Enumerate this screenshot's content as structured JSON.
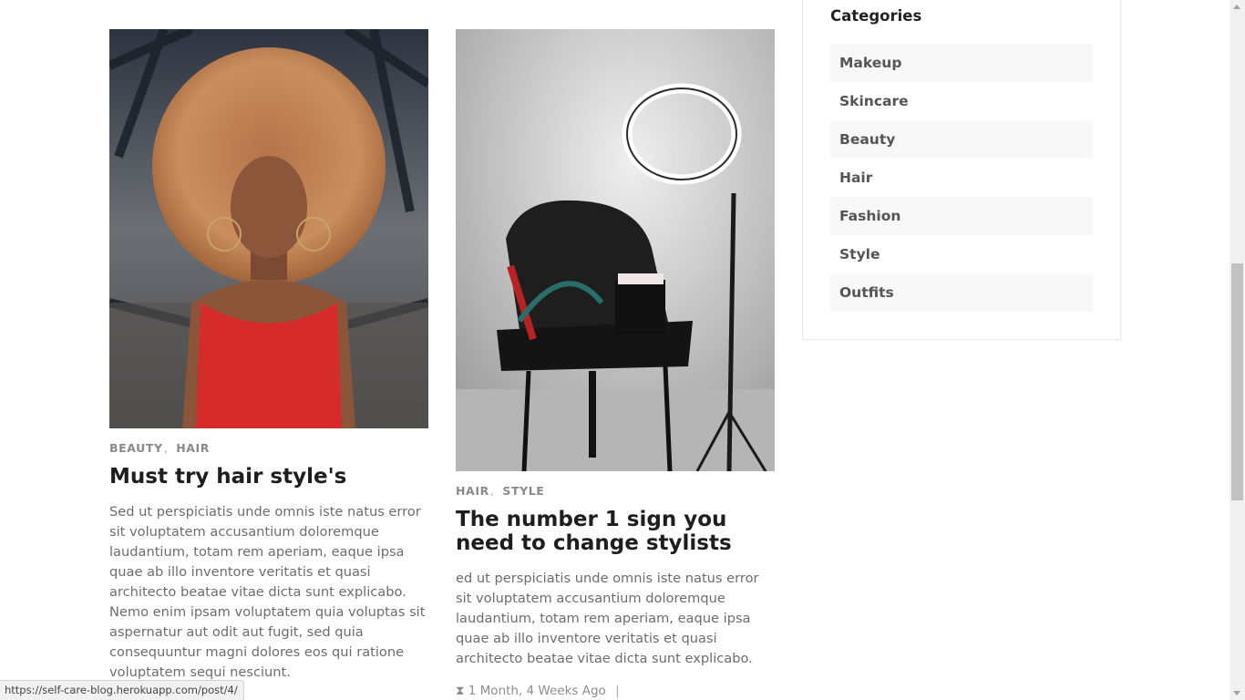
{
  "posts": [
    {
      "categories": [
        "BEAUTY",
        "HAIR"
      ],
      "title": "Must try hair style's",
      "excerpt": "Sed ut perspiciatis unde omnis iste natus error sit voluptatem accusantium doloremque laudantium, totam rem aperiam, eaque ipsa quae ab illo inventore veritatis et quasi architecto beatae vitae dicta sunt explicabo. Nemo enim ipsam voluptatem quia voluptas sit aspernatur aut odit aut fugit, sed quia consequuntur magni dolores eos qui ratione voluptatem sequi nesciunt.",
      "image_icon": "portrait-photo"
    },
    {
      "categories": [
        "HAIR",
        "STYLE"
      ],
      "title": "The number 1 sign you need to change stylists",
      "excerpt": "ed ut perspiciatis unde omnis iste natus error sit voluptatem accusantium doloremque laudantium, totam rem aperiam, eaque ipsa quae ab illo inventore veritatis et quasi architecto beatae vitae dicta sunt explicabo.",
      "meta": {
        "icon": "clock-icon",
        "time": "1 Month, 4 Weeks Ago",
        "separator": "|"
      },
      "image_icon": "salon-chair-photo"
    }
  ],
  "sidebar": {
    "title": "Categories",
    "items": [
      "Makeup",
      "Skincare",
      "Beauty",
      "Hair",
      "Fashion",
      "Style",
      "Outfits"
    ]
  },
  "status_bar": {
    "url": "https://self-care-blog.herokuapp.com/post/4/"
  },
  "colors": {
    "dress_red": "#d62b2b",
    "text_muted": "#6d6d6d",
    "category_gray": "#8a8a8a"
  }
}
